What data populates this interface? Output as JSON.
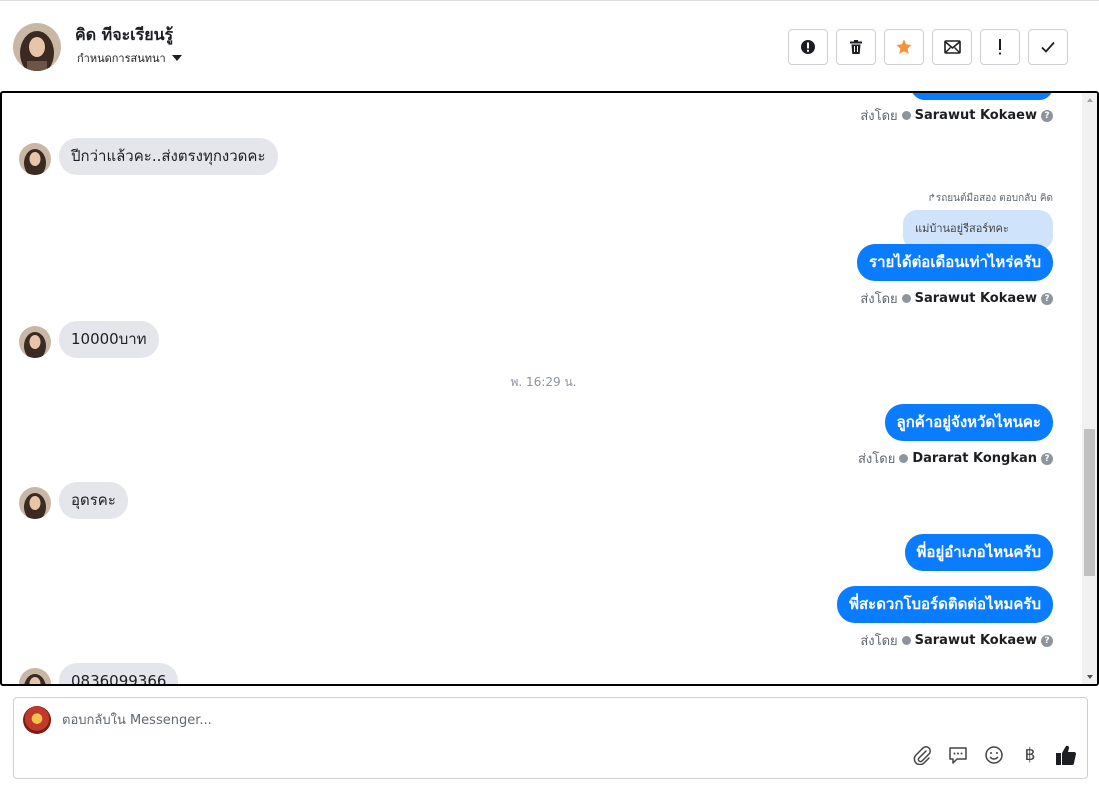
{
  "header": {
    "contact_name": "คิด ทีจะเรียนรู้",
    "assign_label": "กำหนดการสนทนา",
    "actions": [
      {
        "icon": "alert-circle-icon"
      },
      {
        "icon": "trash-icon"
      },
      {
        "icon": "star-icon",
        "color": "#f7923a"
      },
      {
        "icon": "envelope-icon"
      },
      {
        "icon": "exclamation-icon"
      },
      {
        "icon": "check-icon"
      }
    ]
  },
  "conversation": {
    "sent_by_label": "ส่งโดย",
    "messages": [
      {
        "type": "sent_by",
        "agent": "Sarawut Kokaew"
      },
      {
        "type": "incoming",
        "text": "ปีกว่าแล้วคะ..ส่งตรงทุกงวดคะ"
      },
      {
        "type": "reply_context",
        "text": "รถยนต์มือสอง ตอบกลับ คิด",
        "quoted": "แม่บ้านอยู่รีสอร์ทคะ"
      },
      {
        "type": "outgoing",
        "text": "รายได้ต่อเดือนเท่าไหร่ครับ"
      },
      {
        "type": "sent_by",
        "agent": "Sarawut Kokaew"
      },
      {
        "type": "incoming",
        "text": "10000บาท"
      },
      {
        "type": "timestamp",
        "text": "พ. 16:29 น."
      },
      {
        "type": "outgoing",
        "text": "ลูกค้าอยู่จังหวัดไหนคะ"
      },
      {
        "type": "sent_by",
        "agent": "Dararat Kongkan"
      },
      {
        "type": "incoming",
        "text": "อุดรคะ"
      },
      {
        "type": "outgoing",
        "text": "พี่อยู่อำเภอไหนครับ"
      },
      {
        "type": "outgoing",
        "text": "พี่สะดวกโบอร์ดติดต่อไหมครับ"
      },
      {
        "type": "sent_by",
        "agent": "Sarawut Kokaew"
      },
      {
        "type": "incoming",
        "text": "0836099366"
      }
    ]
  },
  "composer": {
    "placeholder": "ตอบกลับใน Messenger...",
    "tools": [
      "paperclip-icon",
      "chat-bubble-icon",
      "smile-icon",
      "baht-icon",
      "thumbs-up-icon"
    ],
    "baht_symbol": "฿"
  },
  "colors": {
    "outgoing_bubble": "#0a7cff",
    "incoming_bubble": "#e4e6eb",
    "quoted_bubble": "#cfe3fb"
  }
}
